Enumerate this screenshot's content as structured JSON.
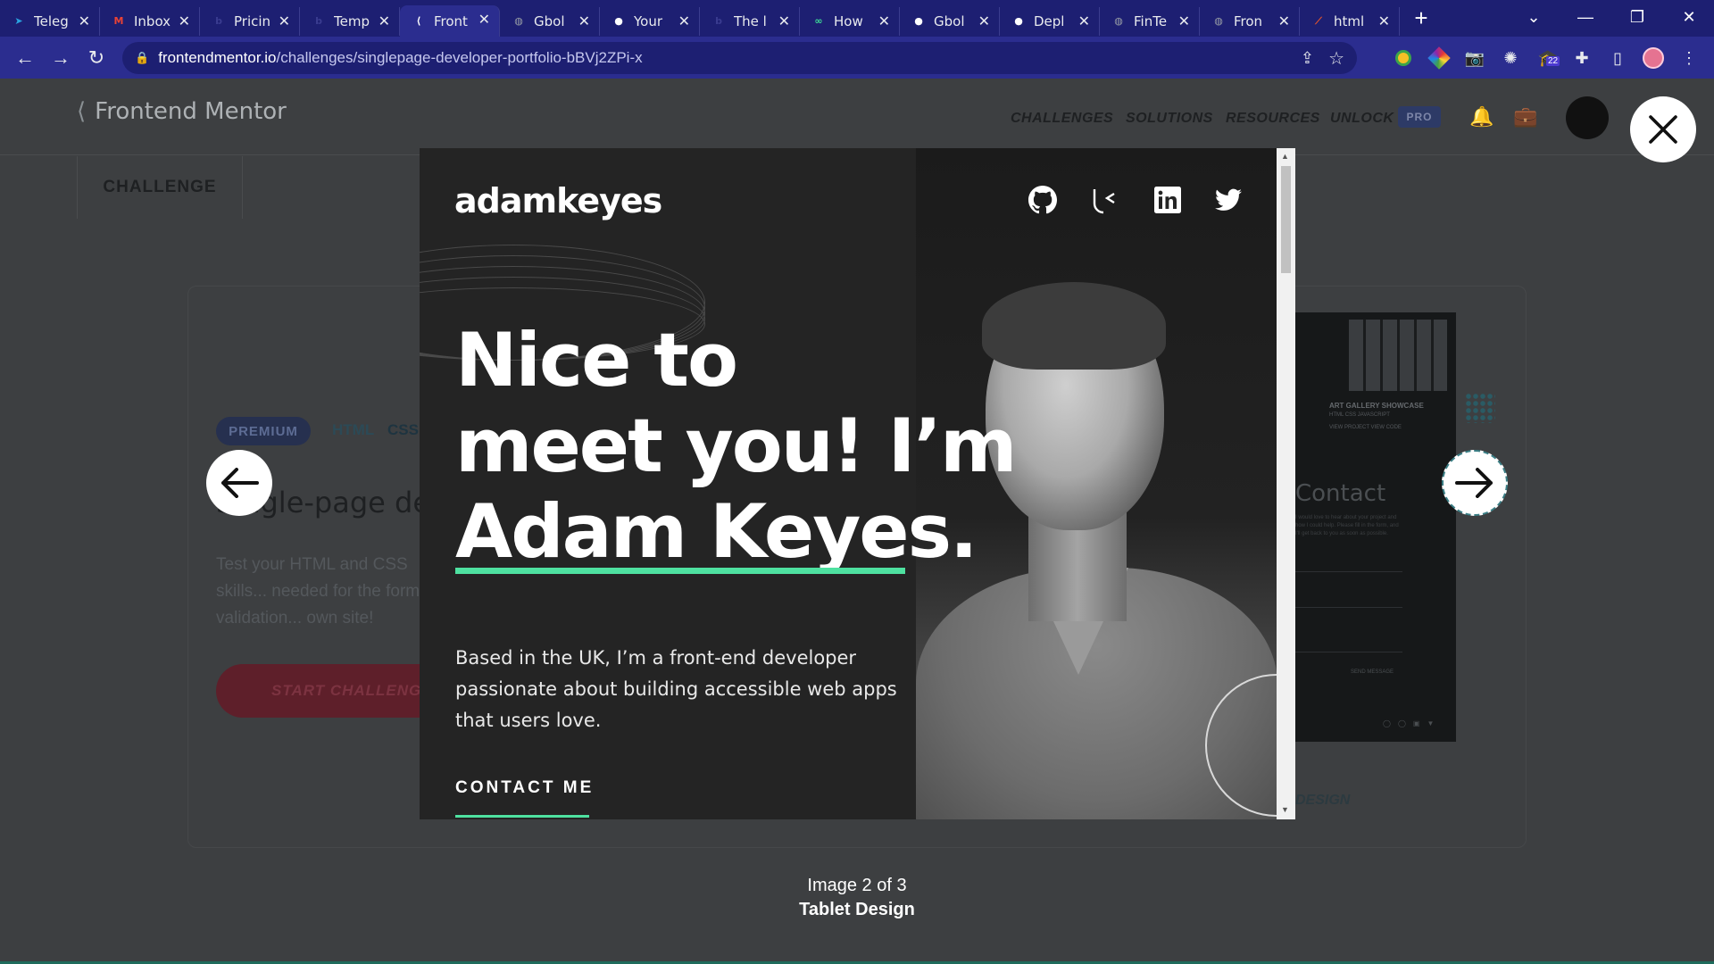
{
  "browser": {
    "tabs": [
      {
        "label": "Teleg",
        "icon": "telegram-icon",
        "color": "#2aa3e0"
      },
      {
        "label": "Inbox",
        "icon": "gmail-icon",
        "color": "#ea4335"
      },
      {
        "label": "Pricin",
        "icon": "b-icon",
        "color": "#3a3c90"
      },
      {
        "label": "Temp",
        "icon": "b-icon",
        "color": "#3a3c90"
      },
      {
        "label": "Front",
        "icon": "frontendmentor-icon",
        "color": "#ffffff",
        "active": true
      },
      {
        "label": "Gbol",
        "icon": "globe-icon",
        "color": "#9aa0a6"
      },
      {
        "label": "Your",
        "icon": "github-icon",
        "color": "#ffffff"
      },
      {
        "label": "The l",
        "icon": "b-icon",
        "color": "#3a3c90"
      },
      {
        "label": "How",
        "icon": "glasses-icon",
        "color": "#3ddc97"
      },
      {
        "label": "Gbol",
        "icon": "github-icon",
        "color": "#ffffff"
      },
      {
        "label": "Depl",
        "icon": "github-icon",
        "color": "#ffffff"
      },
      {
        "label": "FinTe",
        "icon": "globe-icon",
        "color": "#9aa0a6"
      },
      {
        "label": "Fron",
        "icon": "globe-icon",
        "color": "#9aa0a6"
      },
      {
        "label": "html",
        "icon": "html-icon",
        "color": "#e8552b"
      }
    ],
    "url_domain": "frontendmentor.io",
    "url_path": "/challenges/singlepage-developer-portfolio-bBVj2ZPi-x",
    "extension_badge": "22"
  },
  "site": {
    "logo_text": "Frontend Mentor",
    "nav": [
      "CHALLENGES",
      "SOLUTIONS",
      "RESOURCES",
      "UNLOCK"
    ],
    "pro_badge": "PRO",
    "subnav": "CHALLENGE"
  },
  "background": {
    "badge": "PREMIUM",
    "tag_html": "HTML",
    "tag_css": "CSS",
    "title": "Single-page developer portfolio",
    "description": "Test your HTML and CSS skills... needed for the form validation... own site!",
    "cta": "START CHALLENGE",
    "preview_title": "ART GALLERY SHOWCASE",
    "preview_sub": "HTML CSS JAVASCRIPT",
    "preview_btns": "VIEW PROJECT   VIEW CODE",
    "preview_contact": "Contact",
    "preview_ctext": "I would love to hear about your project and how I could help. Please fill in the form, and I'll get back to you as soon as possible.",
    "preview_send": "SEND MESSAGE",
    "design_label": "DESIGN"
  },
  "lightbox": {
    "logo": "adamkeyes",
    "headline_1": "Nice to",
    "headline_2": "meet you! I’m",
    "headline_3": "Adam Keyes.",
    "bio_1": "Based in the UK, I’m a front-end developer",
    "bio_2": "passionate about building accessible web apps",
    "bio_3": "that users love.",
    "contact": "CONTACT ME",
    "counter": "Image 2 of 3",
    "caption": "Tablet Design",
    "accent": "#4ee1a0"
  }
}
